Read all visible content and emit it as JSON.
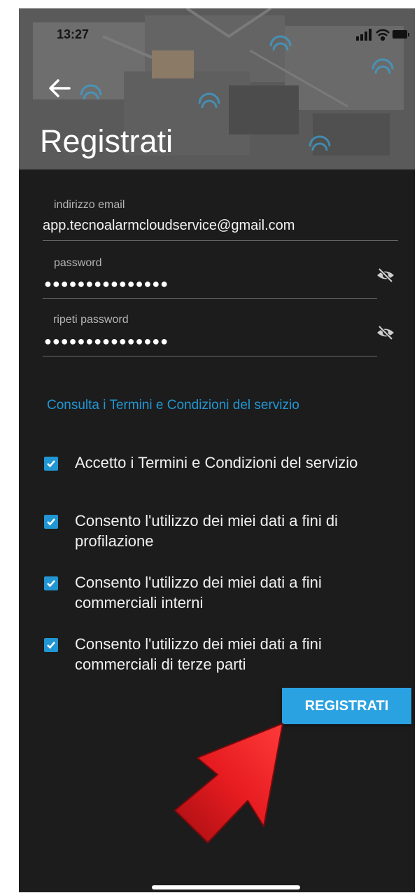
{
  "status_bar": {
    "time": "13:27"
  },
  "header": {
    "title": "Registrati"
  },
  "fields": {
    "email": {
      "label": "indirizzo email",
      "value": "app.tecnoalarmcloudservice@gmail.com"
    },
    "password": {
      "label": "password",
      "value": "●●●●●●●●●●●●●●●"
    },
    "repeat_password": {
      "label": "ripeti password",
      "value": "●●●●●●●●●●●●●●●"
    }
  },
  "terms_link": "Consulta i Termini e Condizioni del servizio",
  "consents": [
    {
      "text": "Accetto i Termini e Condizioni del servizio",
      "checked": true
    },
    {
      "text": "Consento l'utilizzo dei miei dati a fini di profilazione",
      "checked": true
    },
    {
      "text": "Consento l'utilizzo dei miei dati a fini commerciali interni",
      "checked": true
    },
    {
      "text": "Consento l'utilizzo dei miei dati a fini commerciali di terze parti",
      "checked": true
    }
  ],
  "submit_label": "REGISTRATI",
  "colors": {
    "accent": "#2196d3",
    "button": "#2aa1e0",
    "background": "#1c1c1c",
    "arrow": "#e0191c"
  },
  "icons": {
    "back": "arrow-left-icon",
    "visibility": "eye-off-icon",
    "annotation": "red-arrow-icon"
  }
}
